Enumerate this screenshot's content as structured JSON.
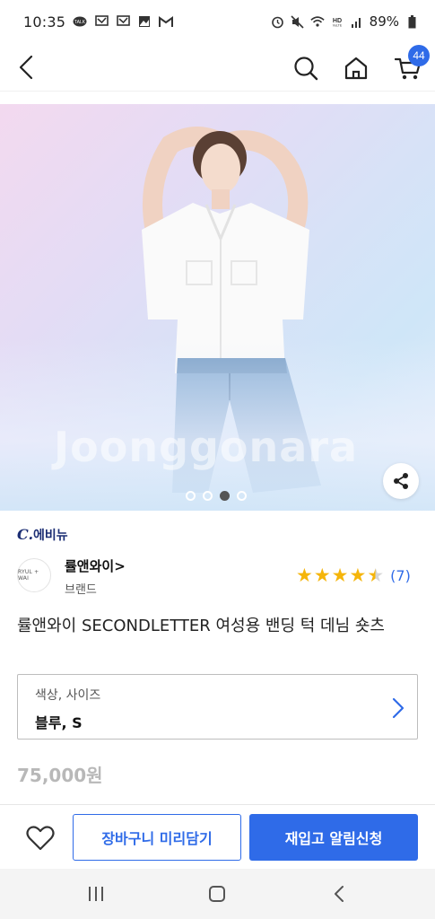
{
  "status_bar": {
    "time": "10:35",
    "battery": "89%",
    "icons_left": [
      "talk-icon",
      "message-icon",
      "message-icon",
      "gallery-icon",
      "gmail-icon"
    ],
    "icons_right": [
      "alarm-icon",
      "mute-icon",
      "wifi-icon",
      "hd-voice-icon",
      "signal-icon",
      "battery-icon"
    ]
  },
  "nav": {
    "cart_count": "44",
    "icons": [
      "back-icon",
      "search-icon",
      "home-icon",
      "cart-icon"
    ]
  },
  "hero": {
    "watermark": "Joonggonara",
    "slide_count": 4,
    "active_slide": 3
  },
  "store": {
    "logo_prefix": "C.",
    "logo_text": "에비뉴"
  },
  "brand": {
    "avatar_text": "RYUL + WAI",
    "name": "률앤와이>",
    "type": "브랜드"
  },
  "rating": {
    "stars": 4.5,
    "review_count": "(7)"
  },
  "product": {
    "title": "률앤와이 SECONDLETTER 여성용 밴딩 턱 데님 숏츠",
    "option_label": "색상, 사이즈",
    "option_value": "블루, S",
    "price": "75,000원"
  },
  "actions": {
    "cart_label": "장바구니 미리담기",
    "restock_label": "재입고 알림신청"
  },
  "colors": {
    "accent": "#2f6be8",
    "star": "#f5b50a",
    "price_disabled": "#b8b8b8",
    "store_logo": "#1c2e74"
  }
}
